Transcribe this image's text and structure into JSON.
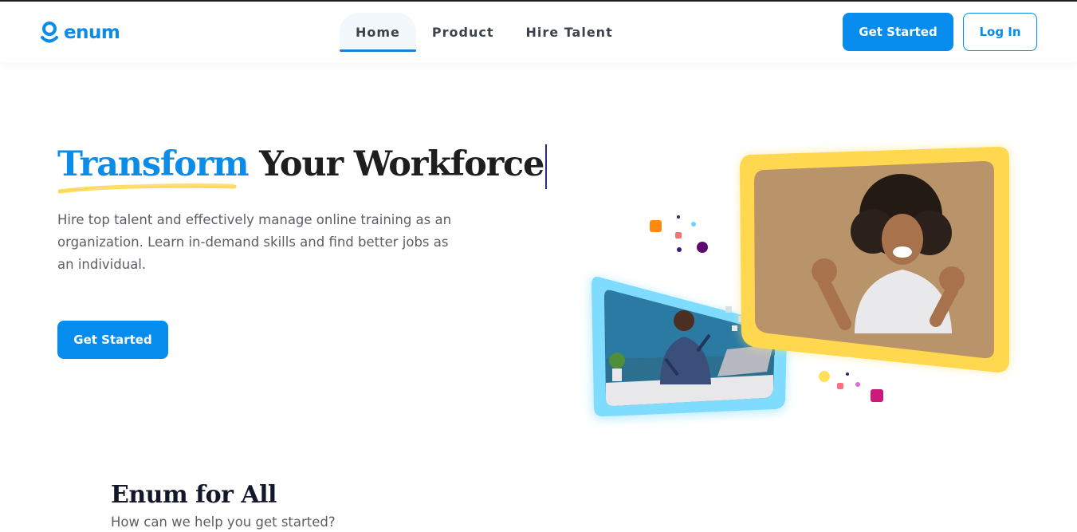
{
  "brand": {
    "name": "enum",
    "color": "#0a8ce8",
    "icon": "enum-logo-icon"
  },
  "nav": {
    "items": [
      {
        "label": "Home",
        "active": true
      },
      {
        "label": "Product",
        "active": false
      },
      {
        "label": "Hire Talent",
        "active": false
      }
    ]
  },
  "header_actions": {
    "get_started_label": "Get Started",
    "login_label": "Log In"
  },
  "hero": {
    "title_accent": "Transform",
    "title_rest": " Your Workforce",
    "subtitle": "Hire top talent and effectively manage online training as an organization. Learn in-demand skills and find better jobs as an individual.",
    "cta_label": "Get Started"
  },
  "section": {
    "title": "Enum for All",
    "subtitle": "How can we help you get started?"
  },
  "colors": {
    "primary": "#058ced",
    "accent_yellow": "#ffd84f",
    "accent_cyan": "#7fdcff",
    "text_dark": "#1e1e1e",
    "text_muted": "#5a5f66"
  }
}
